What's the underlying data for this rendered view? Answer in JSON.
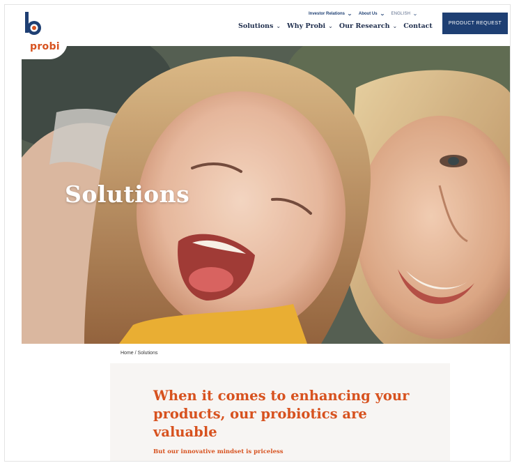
{
  "brand": {
    "logo_text": "probi",
    "accent": "#d7521f",
    "navy": "#1e3f73"
  },
  "utility_nav": [
    {
      "label": "Investor Relations",
      "icon": "chevron-down-icon"
    },
    {
      "label": "About Us",
      "icon": "chevron-down-icon"
    },
    {
      "label": "ENGLISH",
      "icon": "chevron-down-icon"
    }
  ],
  "main_nav": [
    {
      "label": "Solutions",
      "icon": "chevron-down-icon"
    },
    {
      "label": "Why Probi",
      "icon": "chevron-down-icon"
    },
    {
      "label": "Our Research",
      "icon": "chevron-down-icon"
    },
    {
      "label": "Contact"
    }
  ],
  "cta": {
    "label": "PRODUCT REQUEST"
  },
  "hero": {
    "title": "Solutions"
  },
  "breadcrumb": {
    "home": "Home",
    "separator": "/",
    "current": "Solutions"
  },
  "intro": {
    "heading": "When it comes to enhancing your products, our probiotics are valuable",
    "subheading": "But our innovative mindset is priceless"
  }
}
